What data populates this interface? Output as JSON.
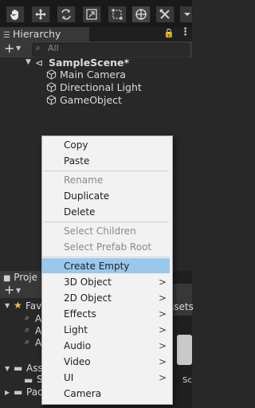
{
  "toolbar": {
    "tools": [
      "hand-tool",
      "move-tool",
      "rotate-tool",
      "scale-tool",
      "rect-tool",
      "transform-tool",
      "custom-tool"
    ]
  },
  "hierarchy": {
    "tab_label": "Hierarchy",
    "add_label": "+",
    "search_placeholder": "All",
    "scene_name": "SampleScene*",
    "items": [
      {
        "label": "Main Camera"
      },
      {
        "label": "Directional Light"
      },
      {
        "label": "GameObject"
      }
    ]
  },
  "context_menu": {
    "items": [
      {
        "label": "Copy",
        "enabled": true
      },
      {
        "label": "Paste",
        "enabled": true
      },
      {
        "label": "Rename",
        "enabled": false
      },
      {
        "label": "Duplicate",
        "enabled": true
      },
      {
        "label": "Delete",
        "enabled": true
      },
      {
        "label": "Select Children",
        "enabled": false
      },
      {
        "label": "Select Prefab Root",
        "enabled": false
      },
      {
        "label": "Create Empty",
        "enabled": true,
        "highlighted": true
      },
      {
        "label": "3D Object",
        "enabled": true,
        "submenu": true
      },
      {
        "label": "2D Object",
        "enabled": true,
        "submenu": true
      },
      {
        "label": "Effects",
        "enabled": true,
        "submenu": true
      },
      {
        "label": "Light",
        "enabled": true,
        "submenu": true
      },
      {
        "label": "Audio",
        "enabled": true,
        "submenu": true
      },
      {
        "label": "Video",
        "enabled": true,
        "submenu": true
      },
      {
        "label": "UI",
        "enabled": true,
        "submenu": true
      },
      {
        "label": "Camera",
        "enabled": true
      }
    ],
    "submenu_arrow": ">"
  },
  "project": {
    "tab_label": "Proje",
    "add_label": "+",
    "favorites_label": "Fav",
    "favorites_items": [
      "A",
      "A",
      "A"
    ],
    "assets_label": "Ass",
    "assets_children": [
      "S"
    ],
    "packages_label": "Pac",
    "right_header": "ssets",
    "right_tile_label": "Sc"
  },
  "colors": {
    "menu_bg": "#f2f2f2",
    "menu_highlight": "#99c8ec",
    "panel_bg": "#282828",
    "toolbar_bg": "#191919"
  }
}
